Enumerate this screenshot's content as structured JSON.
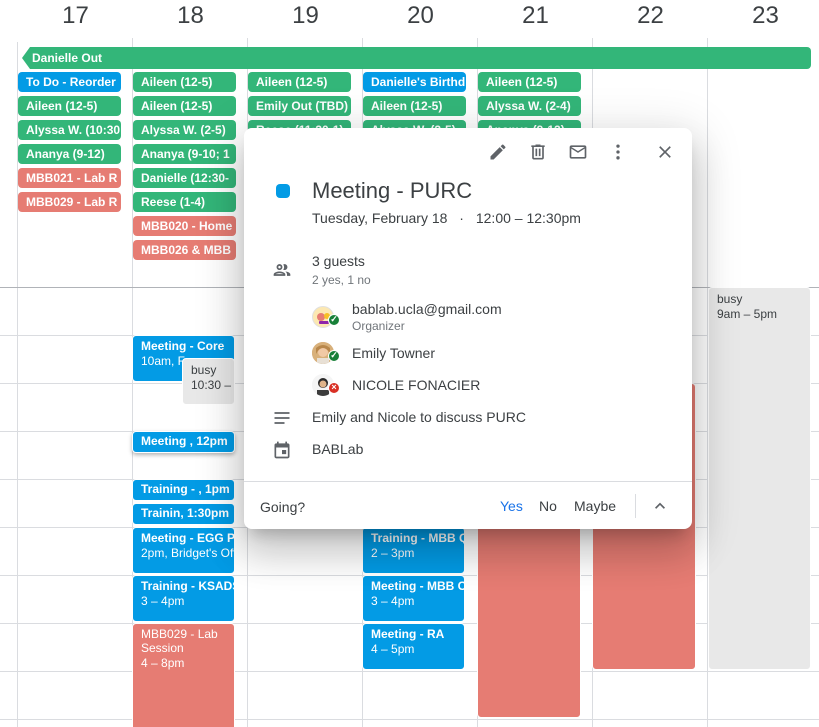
{
  "days": [
    "17",
    "18",
    "19",
    "20",
    "21",
    "22",
    "23"
  ],
  "allday": {
    "banner": "Danielle Out",
    "chips": [
      {
        "col": 0,
        "row": 0,
        "label": "To Do - Reorder",
        "color": "blue"
      },
      {
        "col": 0,
        "row": 1,
        "label": "Aileen (12-5)",
        "color": "green"
      },
      {
        "col": 0,
        "row": 2,
        "label": "Alyssa W. (10:30",
        "color": "green"
      },
      {
        "col": 0,
        "row": 3,
        "label": "Ananya (9-12)",
        "color": "green"
      },
      {
        "col": 0,
        "row": 4,
        "label": "MBB021 - Lab R",
        "color": "red"
      },
      {
        "col": 0,
        "row": 5,
        "label": "MBB029 - Lab R",
        "color": "red"
      },
      {
        "col": 1,
        "row": 0,
        "label": "Aileen (12-5)",
        "color": "green"
      },
      {
        "col": 1,
        "row": 1,
        "label": "Aileen (12-5)",
        "color": "green"
      },
      {
        "col": 1,
        "row": 2,
        "label": "Alyssa W. (2-5)",
        "color": "green"
      },
      {
        "col": 1,
        "row": 3,
        "label": "Ananya (9-10; 1",
        "color": "green"
      },
      {
        "col": 1,
        "row": 4,
        "label": "Danielle (12:30-",
        "color": "green"
      },
      {
        "col": 1,
        "row": 5,
        "label": "Reese (1-4)",
        "color": "green"
      },
      {
        "col": 1,
        "row": 6,
        "label": "MBB020 - Home",
        "color": "red"
      },
      {
        "col": 1,
        "row": 7,
        "label": "MBB026 & MBB",
        "color": "red"
      },
      {
        "col": 2,
        "row": 0,
        "label": "Aileen (12-5)",
        "color": "green"
      },
      {
        "col": 2,
        "row": 1,
        "label": "Emily Out (TBD)",
        "color": "green"
      },
      {
        "col": 2,
        "row": 2,
        "label": "Reese (11:30-1)",
        "color": "green"
      },
      {
        "col": 3,
        "row": 0,
        "label": "Danielle's Birthd",
        "color": "blue"
      },
      {
        "col": 3,
        "row": 1,
        "label": "Aileen (12-5)",
        "color": "green"
      },
      {
        "col": 3,
        "row": 2,
        "label": "Alyssa W. (2-5)",
        "color": "green"
      },
      {
        "col": 4,
        "row": 0,
        "label": "Aileen (12-5)",
        "color": "green"
      },
      {
        "col": 4,
        "row": 1,
        "label": "Alyssa W. (2-4)",
        "color": "green"
      },
      {
        "col": 4,
        "row": 2,
        "label": "Ananya (9-12)",
        "color": "green"
      }
    ]
  },
  "events": {
    "mon_core_title": "Meeting - Core",
    "mon_core_time": "10am, F",
    "busy_label": "busy",
    "busy_time_1030": "10:30 –",
    "mon_meeting_noon": "Meeting , 12pm",
    "mon_training_1": "Training - , 1pm",
    "mon_training_2": "Trainin, 1:30pm",
    "mon_egg_title": "Meeting - EGG Pr",
    "mon_egg_time": "2pm, Bridget's Off",
    "mon_ksads_title": "Training - KSADS",
    "mon_ksads_time": "3 – 4pm",
    "mon_mbb029_title": "MBB029 - Lab Session",
    "mon_mbb029_time": "4 – 8pm",
    "thu_training_mbbq_title": "Training - MBB Qu",
    "thu_training_mbbq_time": "2 – 3pm",
    "thu_meeting_mbbcl_title": "Meeting - MBB Cl",
    "thu_meeting_mbbcl_time": "3 – 4pm",
    "thu_meeting_ra_title": "Meeting - RA",
    "thu_meeting_ra_time": "4 – 5pm",
    "sat_busy_time": "9am – 5pm"
  },
  "popup": {
    "title": "Meeting - PURC",
    "date": "Tuesday, February 18",
    "separator": "·",
    "time": "12:00 – 12:30pm",
    "guests_count": "3 guests",
    "guests_summary": "2 yes, 1 no",
    "guests": [
      {
        "name": "bablab.ucla@gmail.com",
        "role": "Organizer",
        "status": "yes"
      },
      {
        "name": "Emily Towner",
        "role": "",
        "status": "yes"
      },
      {
        "name": "NICOLE FONACIER",
        "role": "",
        "status": "no"
      }
    ],
    "description": "Emily and Nicole to discuss PURC",
    "calendar": "BABLab",
    "going_label": "Going?",
    "rsvp_yes": "Yes",
    "rsvp_no": "No",
    "rsvp_maybe": "Maybe",
    "colors": {
      "event": "#039be5",
      "accent": "#1a73e8",
      "yes": "#188038",
      "no": "#d93025"
    }
  }
}
